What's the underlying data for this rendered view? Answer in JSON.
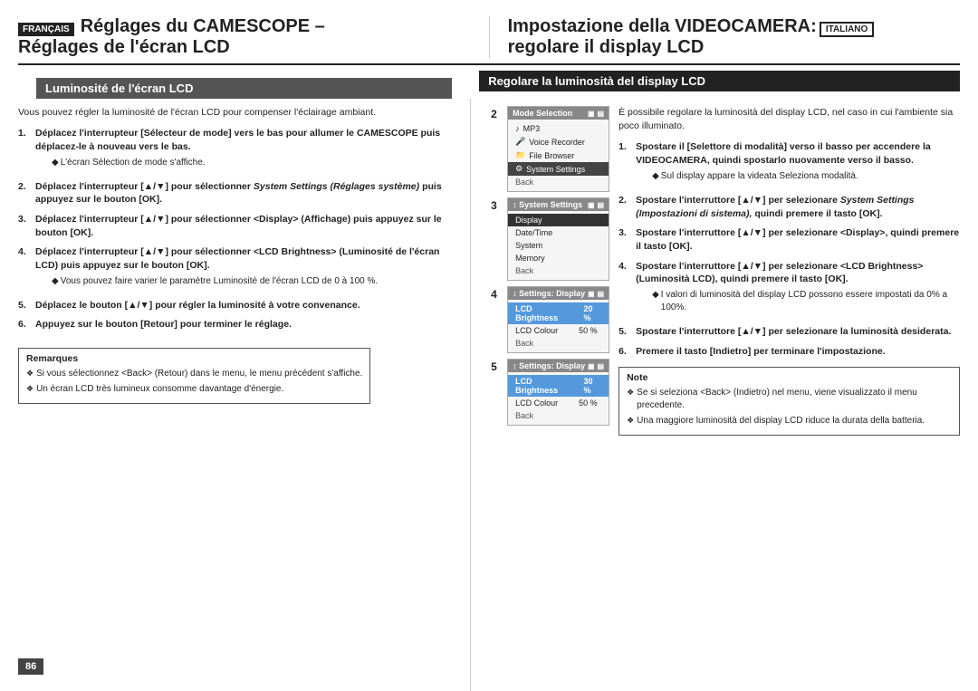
{
  "page": {
    "page_number": "86"
  },
  "left": {
    "lang_badge": "FRANÇAIS",
    "title_line1": "Réglages du CAMESCOPE –",
    "title_line2": "Réglages de l'écran LCD",
    "section_heading": "Luminosité de l'écran LCD",
    "intro": "Vous pouvez régler la luminosité de l'écran LCD pour compenser l'éclairage ambiant.",
    "steps": [
      {
        "num": "1.",
        "text": "Déplacez l'interrupteur [Sélecteur de mode] vers le bas pour allumer le CAMESCOPE puis déplacez-le à nouveau vers le bas.",
        "note": "L'écran Sélection de mode s'affiche."
      },
      {
        "num": "2.",
        "text_before": "Déplacez l'interrupteur [▲/▼] pour sélectionner ",
        "italic": "System Settings (Réglages système)",
        "text_after": " puis appuyez sur le bouton [OK].",
        "note": null
      },
      {
        "num": "3.",
        "text": "Déplacez l'interrupteur [▲/▼] pour sélectionner <Display> (Affichage) puis appuyez sur le bouton [OK].",
        "note": null
      },
      {
        "num": "4.",
        "text": "Déplacez l'interrupteur [▲/▼] pour sélectionner <LCD Brightness> (Luminosité de l'écran LCD) puis appuyez sur le bouton [OK].",
        "note": "Vous pouvez faire varier le paramètre Luminosité de l'écran LCD de 0 à 100 %."
      },
      {
        "num": "5.",
        "text": "Déplacez le bouton [▲/▼] pour régler la luminosité à votre convenance.",
        "note": null
      },
      {
        "num": "6.",
        "text": "Appuyez sur le bouton [Retour] pour terminer le réglage.",
        "note": null
      }
    ],
    "remarques_title": "Remarques",
    "remarques": [
      "Si vous sélectionnez <Back> (Retour) dans le menu, le menu précédent s'affiche.",
      "Un écran LCD très lumineux consomme davantage d'énergie."
    ]
  },
  "right": {
    "lang_badge": "ITALIANO",
    "title_line1": "Impostazione della VIDEOCAMERA:",
    "title_line2": "regolare il display LCD",
    "section_heading": "Regolare la luminosità del display LCD",
    "intro": "È possibile regolare la luminosità del display LCD, nel caso in cui l'ambiente sia poco illuminato.",
    "steps": [
      {
        "num": "1.",
        "text": "Spostare il [Selettore di modalità] verso il basso per accendere la VIDEOCAMERA, quindi spostarlo nuovamente verso il basso.",
        "note": "Sul display appare la videata Seleziona modalità."
      },
      {
        "num": "2.",
        "text_before": "Spostare l'interruttore [▲/▼] per selezionare ",
        "italic": "System Settings (Impostazioni di sistema),",
        "text_after": " quindi premere il tasto [OK].",
        "note": null
      },
      {
        "num": "3.",
        "text": "Spostare l'interruttore [▲/▼] per selezionare <Display>, quindi premere il tasto [OK].",
        "note": null
      },
      {
        "num": "4.",
        "text": "Spostare l'interruttore [▲/▼] per selezionare <LCD Brightness> (Luminosità LCD), quindi premere il tasto [OK].",
        "note": "I valori di luminosità del display LCD possono essere impostati da 0% a 100%."
      },
      {
        "num": "5.",
        "text": "Spostare l'interruttore [▲/▼] per selezionare la luminosità desiderata.",
        "note": null
      },
      {
        "num": "6.",
        "text": "Premere il tasto [Indietro] per terminare l'impostazione.",
        "note": null
      }
    ],
    "note_title": "Note",
    "notes": [
      "Se si seleziona <Back> (Indietro) nel menu, viene visualizzato il menu precedente.",
      "Una maggiore luminosità del display LCD riduce la durata della batteria."
    ]
  },
  "screens": [
    {
      "num": "2",
      "title": "Mode Selection",
      "items": [
        {
          "icon": "♪",
          "label": "MP3",
          "selected": false
        },
        {
          "icon": "🎤",
          "label": "Voice Recorder",
          "selected": false
        },
        {
          "icon": "📁",
          "label": "File Browser",
          "selected": false
        },
        {
          "icon": "⚙",
          "label": "System Settings",
          "selected": true
        }
      ],
      "back": "Back"
    },
    {
      "num": "3",
      "title": "↕ System Settings",
      "items": [
        {
          "label": "Display",
          "selected": true
        },
        {
          "label": "Date/Time",
          "selected": false
        },
        {
          "label": "System",
          "selected": false
        },
        {
          "label": "Memory",
          "selected": false
        }
      ],
      "back": "Back"
    },
    {
      "num": "4",
      "title": "↕ Settings: Display",
      "items": [
        {
          "label": "LCD Brightness",
          "value": "20 %",
          "selected": true
        },
        {
          "label": "LCD Colour",
          "value": "50 %",
          "selected": false
        }
      ],
      "back": "Back"
    },
    {
      "num": "5",
      "title": "↕ Settings: Display",
      "items": [
        {
          "label": "LCD Brightness",
          "value": "30 %",
          "selected": true
        },
        {
          "label": "LCD Colour",
          "value": "50 %",
          "selected": false
        }
      ],
      "back": "Back"
    }
  ]
}
